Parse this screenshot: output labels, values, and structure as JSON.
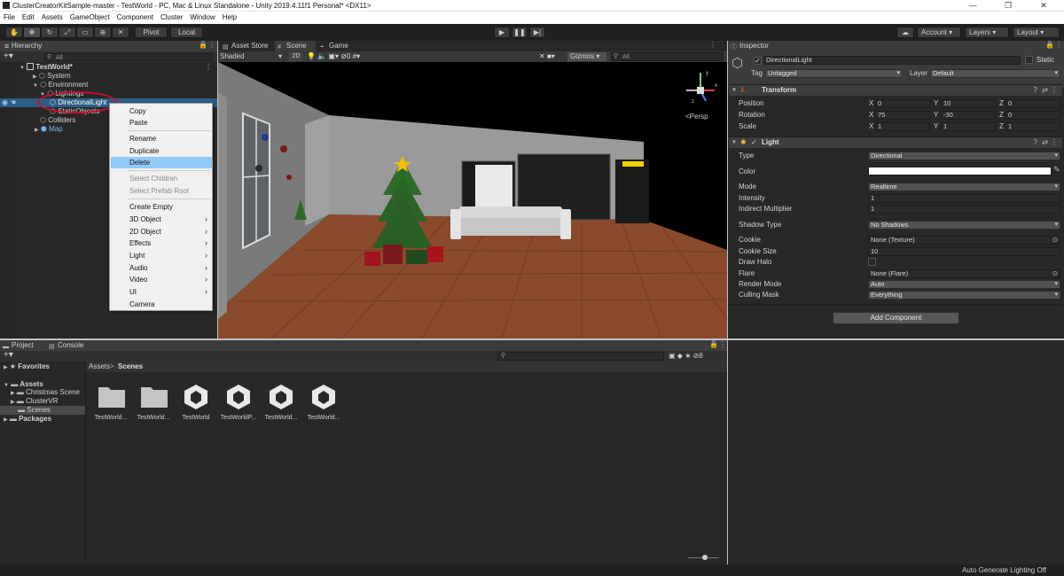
{
  "window": {
    "title": "ClusterCreatorKitSample-master - TestWorld - PC, Mac & Linux Standalone - Unity 2019.4.11f1 Personal* <DX11>",
    "controls": [
      "—",
      "❐",
      "✕"
    ]
  },
  "menu": [
    "File",
    "Edit",
    "Assets",
    "GameObject",
    "Component",
    "Cluster",
    "Window",
    "Help"
  ],
  "toolbar": {
    "pivot": "Pivot",
    "local": "Local",
    "account": "Account",
    "layers": "Layers",
    "layout": "Layout"
  },
  "hierarchy": {
    "tab": "Hierarchy",
    "search_placeholder": "All",
    "root": "TestWorld*",
    "items": [
      "System",
      "Environment",
      "Lightings",
      "DirectionalLight",
      "StaticObjects",
      "Colliders",
      "Map"
    ]
  },
  "context_menu": {
    "items": [
      "Copy",
      "Paste",
      "Rename",
      "Duplicate",
      "Delete",
      "Select Children",
      "Select Prefab Root",
      "Create Empty",
      "3D Object",
      "2D Object",
      "Effects",
      "Light",
      "Audio",
      "Video",
      "UI",
      "Camera"
    ]
  },
  "scene_view": {
    "tabs": [
      "Asset Store",
      "Scene",
      "Game"
    ],
    "shading": "Shaded",
    "mode_2d": "2D",
    "hidden_count": "0",
    "gizmos": "Gizmos",
    "search_placeholder": "All",
    "persp": "<Persp",
    "gizmo_x": "x",
    "gizmo_y": "y",
    "gizmo_z": "z"
  },
  "inspector": {
    "tab": "Inspector",
    "object_name": "DirectionalLight",
    "static": "Static",
    "tag_label": "Tag",
    "tag": "Untagged",
    "layer_label": "Layer",
    "layer": "Default",
    "transform": {
      "title": "Transform",
      "position": {
        "label": "Position",
        "x": "0",
        "y": "10",
        "z": "0"
      },
      "rotation": {
        "label": "Rotation",
        "x": "75",
        "y": "-30",
        "z": "0"
      },
      "scale": {
        "label": "Scale",
        "x": "1",
        "y": "1",
        "z": "1"
      }
    },
    "light": {
      "title": "Light",
      "type": {
        "label": "Type",
        "value": "Directional"
      },
      "color": {
        "label": "Color",
        "value": "#ffffff"
      },
      "mode": {
        "label": "Mode",
        "value": "Realtime"
      },
      "intensity": {
        "label": "Intensity",
        "value": "1"
      },
      "indirect": {
        "label": "Indirect Multiplier",
        "value": "1"
      },
      "shadow": {
        "label": "Shadow Type",
        "value": "No Shadows"
      },
      "cookie": {
        "label": "Cookie",
        "value": "None (Texture)"
      },
      "cookie_size": {
        "label": "Cookie Size",
        "value": "10"
      },
      "draw_halo": {
        "label": "Draw Halo"
      },
      "flare": {
        "label": "Flare",
        "value": "None (Flare)"
      },
      "render_mode": {
        "label": "Render Mode",
        "value": "Auto"
      },
      "culling": {
        "label": "Culling Mask",
        "value": "Everything"
      }
    },
    "add_component": "Add Component",
    "axes": [
      "X",
      "Y",
      "Z"
    ]
  },
  "project": {
    "tabs": [
      "Project",
      "Console"
    ],
    "favorites": "Favorites",
    "assets": "Assets",
    "folders": [
      "Christmas Scene",
      "ClusterVR",
      "Scenes"
    ],
    "packages": "Packages",
    "breadcrumb": [
      "Assets",
      "Scenes"
    ],
    "breadcrumb_sep": ">",
    "hidden_count": "8",
    "items": [
      {
        "label": "TestWorld...",
        "kind": "folder"
      },
      {
        "label": "TestWorld...",
        "kind": "folder"
      },
      {
        "label": "TestWorld",
        "kind": "unity"
      },
      {
        "label": "TestWorldP...",
        "kind": "unity"
      },
      {
        "label": "TestWorld...",
        "kind": "unity"
      },
      {
        "label": "TestWorld...",
        "kind": "unity"
      }
    ]
  },
  "status_bar": "Auto Generate Lighting Off",
  "colors": {
    "selection": "#2c5d87",
    "highlight": "#91c9f7",
    "annotation": "#c8102e"
  }
}
